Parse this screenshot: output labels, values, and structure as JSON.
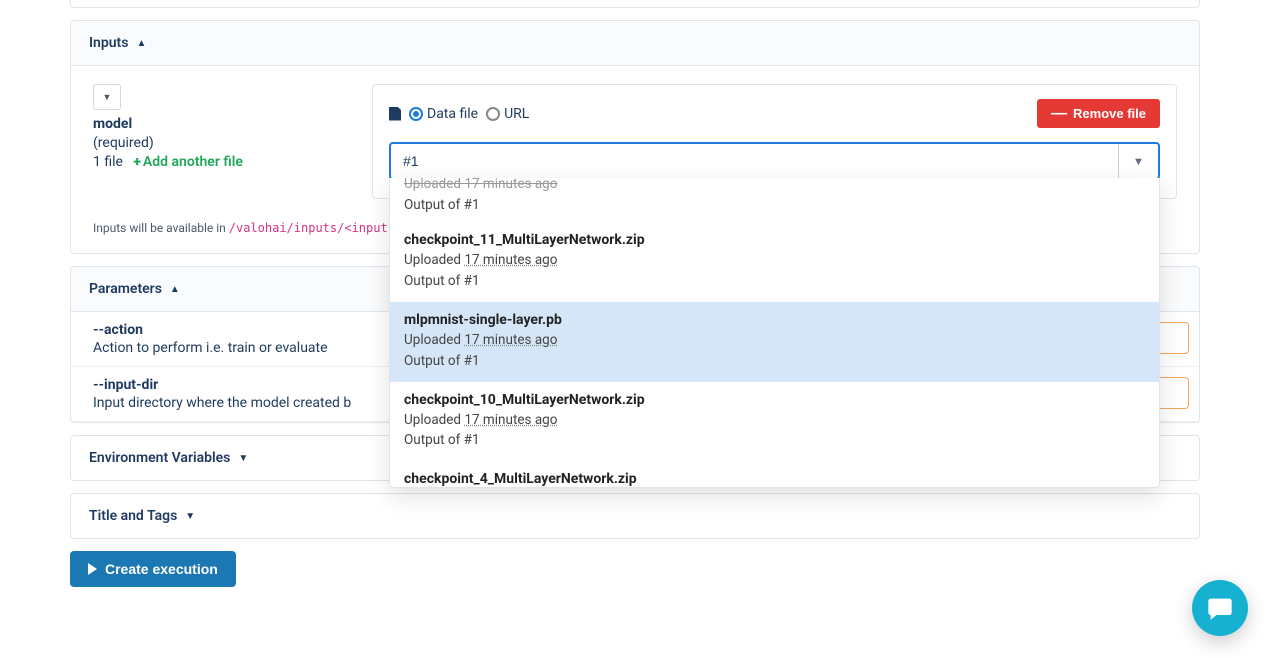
{
  "sections": {
    "inputs": {
      "title": "Inputs"
    },
    "parameters": {
      "title": "Parameters"
    },
    "env": {
      "title": "Environment Variables"
    },
    "title_tags": {
      "title": "Title and Tags"
    }
  },
  "input_block": {
    "name": "model",
    "required_label": "(required)",
    "file_count": "1 file",
    "add_another": "Add another file",
    "path_note_prefix": "Inputs will be available in ",
    "path_note_code": "/valohai/inputs/<input "
  },
  "source": {
    "data_file_label": "Data file",
    "url_label": "URL",
    "remove_label": "Remove file",
    "search_value": "#1"
  },
  "dropdown": {
    "partial_top": {
      "uploaded_prefix": "Uploaded ",
      "ago": "17 minutes ago",
      "output": "Output of #1"
    },
    "items": [
      {
        "title": "checkpoint_11_MultiLayerNetwork.zip",
        "uploaded_prefix": "Uploaded ",
        "ago": "17 minutes ago",
        "output": "Output of #1",
        "highlighted": false
      },
      {
        "title": "mlpmnist-single-layer.pb",
        "uploaded_prefix": "Uploaded ",
        "ago": "17 minutes ago",
        "output": "Output of #1",
        "highlighted": true
      },
      {
        "title": "checkpoint_10_MultiLayerNetwork.zip",
        "uploaded_prefix": "Uploaded ",
        "ago": "17 minutes ago",
        "output": "Output of #1",
        "highlighted": false
      },
      {
        "title": "checkpoint_4_MultiLayerNetwork.zip",
        "uploaded_prefix": "Uploaded ",
        "ago": "",
        "output": "",
        "highlighted": false
      }
    ]
  },
  "params": [
    {
      "name": "--action",
      "desc": "Action to perform i.e. train or evaluate"
    },
    {
      "name": "--input-dir",
      "desc": "Input directory where the model created b"
    }
  ],
  "buttons": {
    "create": "Create execution"
  }
}
